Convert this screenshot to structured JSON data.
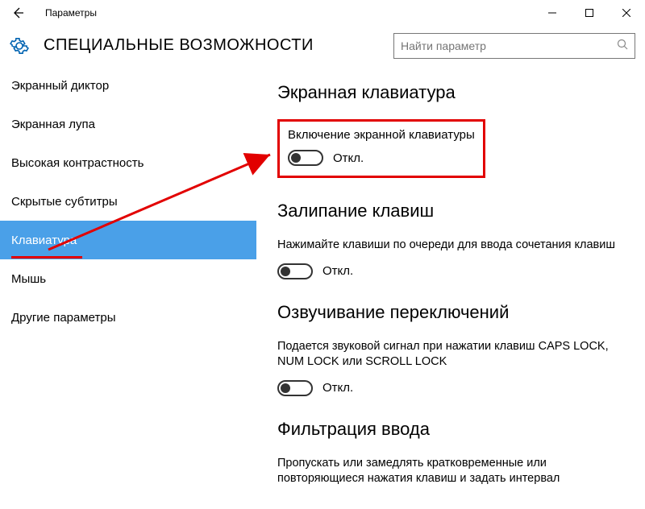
{
  "titlebar": {
    "title": "Параметры"
  },
  "header": {
    "title": "СПЕЦИАЛЬНЫЕ ВОЗМОЖНОСТИ",
    "search_placeholder": "Найти параметр"
  },
  "sidebar": {
    "items": [
      {
        "label": "Экранный диктор"
      },
      {
        "label": "Экранная лупа"
      },
      {
        "label": "Высокая контрастность"
      },
      {
        "label": "Скрытые субтитры"
      },
      {
        "label": "Клавиатура"
      },
      {
        "label": "Мышь"
      },
      {
        "label": "Другие параметры"
      }
    ],
    "selected_index": 4
  },
  "content": {
    "section1": {
      "heading": "Экранная клавиатура",
      "option_label": "Включение экранной клавиатуры",
      "toggle_state": "Откл."
    },
    "section2": {
      "heading": "Залипание клавиш",
      "desc": "Нажимайте клавиши по очереди для ввода сочетания клавиш",
      "toggle_state": "Откл."
    },
    "section3": {
      "heading": "Озвучивание переключений",
      "desc": "Подается звуковой сигнал при нажатии клавиш CAPS LOCK, NUM LOCK или SCROLL LOCK",
      "toggle_state": "Откл."
    },
    "section4": {
      "heading": "Фильтрация ввода",
      "desc": "Пропускать или замедлять кратковременные или повторяющиеся нажатия клавиш и задать интервал"
    }
  },
  "annotation": {
    "highlight_color": "#e20000"
  }
}
